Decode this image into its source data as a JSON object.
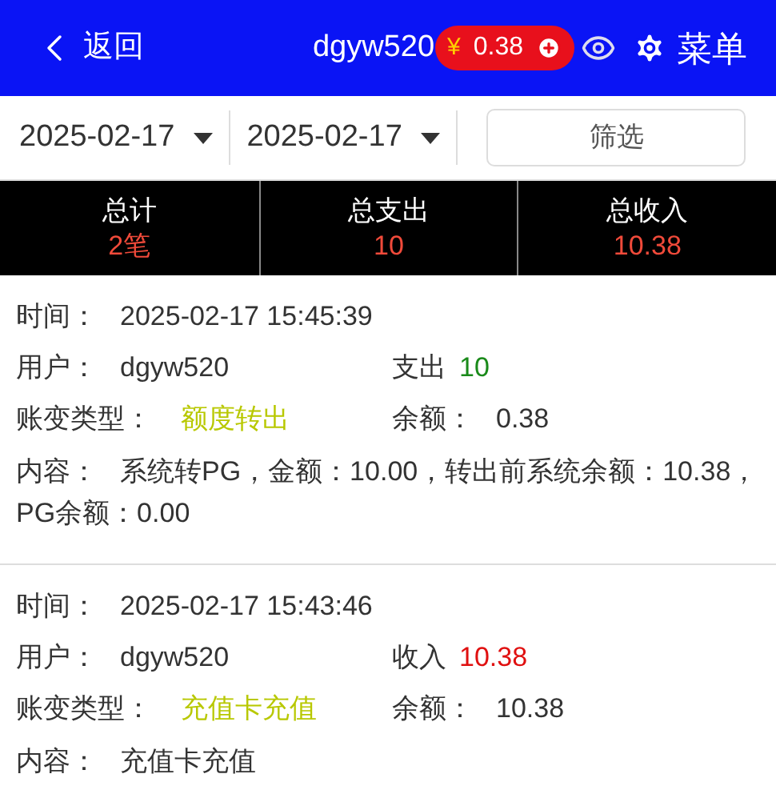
{
  "header": {
    "back_label": "返回",
    "username": "dgyw520",
    "balance": "0.38",
    "currency": "¥",
    "menu_label": "菜单"
  },
  "filters": {
    "start_date": "2025-02-17",
    "end_date": "2025-02-17",
    "filter_button": "筛选"
  },
  "summary": [
    {
      "label": "总计",
      "value": "2笔"
    },
    {
      "label": "总支出",
      "value": "10"
    },
    {
      "label": "总收入",
      "value": "10.38"
    }
  ],
  "records": [
    {
      "time_label": "时间：",
      "time": "2025-02-17 15:45:39",
      "user_label": "用户：",
      "user": "dgyw520",
      "amount_label": "支出",
      "amount": "10",
      "kind": "expense",
      "type_label": "账变类型：",
      "type": "额度转出",
      "balance_label": "余额：",
      "balance": "0.38",
      "content_label": "内容：",
      "content": "系统转PG，金额：10.00，转出前系统余额：10.38，PG余额：0.00"
    },
    {
      "time_label": "时间：",
      "time": "2025-02-17 15:43:46",
      "user_label": "用户：",
      "user": "dgyw520",
      "amount_label": "收入",
      "amount": "10.38",
      "kind": "income",
      "type_label": "账变类型：",
      "type": "充值卡充值",
      "balance_label": "余额：",
      "balance": "10.38",
      "content_label": "内容：",
      "content": "充值卡充值"
    }
  ]
}
